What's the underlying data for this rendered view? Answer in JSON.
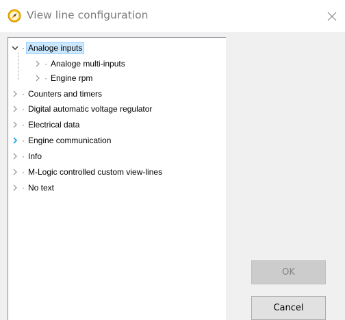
{
  "window": {
    "title": "View line configuration"
  },
  "tree": {
    "items": [
      {
        "label": "Analoge inputs",
        "expanded": true,
        "selected": true
      },
      {
        "label": "Analoge multi-inputs"
      },
      {
        "label": "Engine rpm"
      },
      {
        "label": "Counters and timers"
      },
      {
        "label": "Digital automatic voltage regulator"
      },
      {
        "label": "Electrical data"
      },
      {
        "label": "Engine communication",
        "hovered": true
      },
      {
        "label": "Info"
      },
      {
        "label": "M-Logic controlled custom view-lines"
      },
      {
        "label": "No text"
      }
    ]
  },
  "buttons": {
    "ok_label": "OK",
    "cancel_label": "Cancel"
  },
  "colors": {
    "selection_bg": "#cce8ff",
    "hover_arrow": "#1ba1e2"
  }
}
